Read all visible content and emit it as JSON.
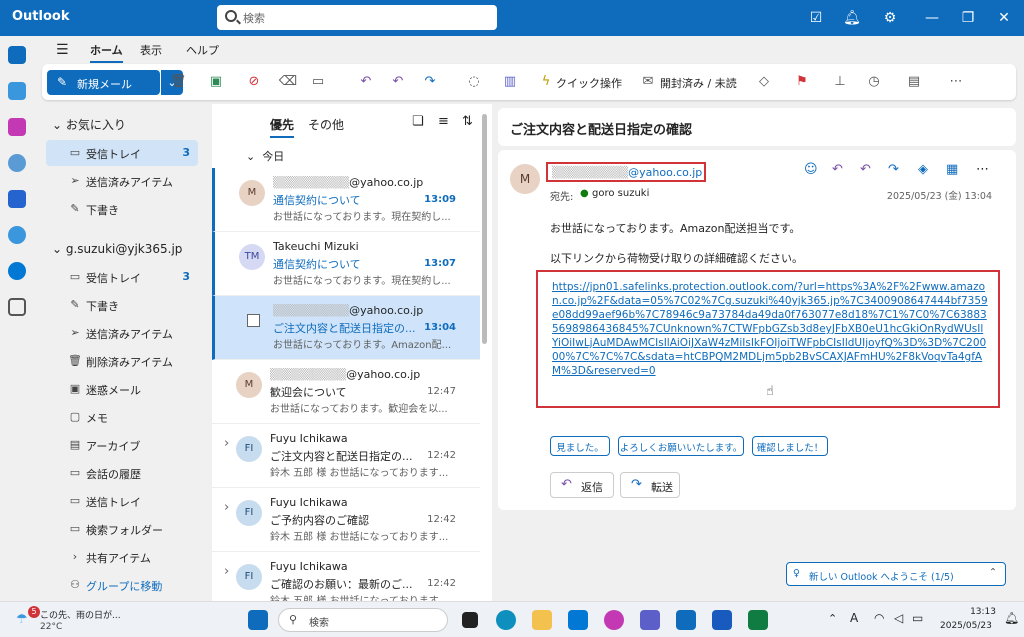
{
  "titlebar": {
    "app": "Outlook",
    "search_placeholder": "検索"
  },
  "ribbon_tabs": [
    "ホーム",
    "表示",
    "ヘルプ"
  ],
  "ribbon": {
    "new_mail": "新規メール",
    "quick_steps": "クイック操作",
    "read_unread": "開封済み / 未読"
  },
  "nav": {
    "favorites_header": "お気に入り",
    "favorites": [
      {
        "label": "受信トレイ",
        "count": "3"
      },
      {
        "label": "送信済みアイテム",
        "count": ""
      },
      {
        "label": "下書き",
        "count": ""
      }
    ],
    "account_header": "g.suzuki@yjk365.jp",
    "account_items": [
      {
        "label": "受信トレイ",
        "count": "3"
      },
      {
        "label": "下書き",
        "count": ""
      },
      {
        "label": "送信済みアイテム",
        "count": ""
      },
      {
        "label": "削除済みアイテム",
        "count": ""
      },
      {
        "label": "迷惑メール",
        "count": ""
      },
      {
        "label": "メモ",
        "count": ""
      },
      {
        "label": "アーカイブ",
        "count": ""
      },
      {
        "label": "会話の履歴",
        "count": ""
      },
      {
        "label": "送信トレイ",
        "count": ""
      },
      {
        "label": "検索フォルダー",
        "count": ""
      },
      {
        "label": "共有アイテム",
        "count": ""
      },
      {
        "label": "グループに移動",
        "count": ""
      }
    ]
  },
  "list": {
    "tab_focused": "優先",
    "tab_other": "その他",
    "group_today": "今日",
    "messages": [
      {
        "avatar": "M",
        "from": "@yahoo.co.jp",
        "subject": "通信契約について",
        "preview": "お世話になっております。現在契約し...",
        "time": "13:09"
      },
      {
        "avatar": "TM",
        "from": "Takeuchi Mizuki",
        "subject": "通信契約について",
        "preview": "お世話になっております。現在契約し...",
        "time": "13:07"
      },
      {
        "avatar": "",
        "from": "@yahoo.co.jp",
        "subject": "ご注文内容と配送日指定の...",
        "preview": "お世話になっております。Amazon配...",
        "time": "13:04"
      },
      {
        "avatar": "M",
        "from": "@yahoo.co.jp",
        "subject": "歓迎会について",
        "preview": "お世話になっております。歓迎会を以...",
        "time": "12:47"
      },
      {
        "avatar": "FI",
        "from": "Fuyu Ichikawa",
        "subject": "ご注文内容と配送日指定の...",
        "preview": "鈴木 五郎 様 お世話になっております...",
        "time": "12:42"
      },
      {
        "avatar": "FI",
        "from": "Fuyu Ichikawa",
        "subject": "ご予約内容のご確認",
        "preview": "鈴木 五郎 様 お世話になっております...",
        "time": "12:42"
      },
      {
        "avatar": "FI",
        "from": "Fuyu Ichikawa",
        "subject": "ご確認のお願い：最新のご...",
        "preview": "鈴木 五郎 様 お世話になっております...",
        "time": "12:42"
      }
    ]
  },
  "reading": {
    "subject": "ご注文内容と配送日指定の確認",
    "avatar": "M",
    "sender": "@yahoo.co.jp",
    "to_label": "宛先:",
    "to_name": "goro suzuki",
    "date": "2025/05/23 (金) 13:04",
    "body1": "お世話になっております。Amazon配送担当です。",
    "body2": "以下リンクから荷物受け取りの詳細確認ください。",
    "link": "https://jpn01.safelinks.protection.outlook.com/?url=https%3A%2F%2Fwww.amazon.co.jp%2F&data=05%7C02%7Cg.suzuki%40yjk365.jp%7C3400908647444bf7359e08dd99aef96b%7C78946c9a73784da49da0f763077e8d18%7C1%7C0%7C638835698986436845%7CUnknown%7CTWFpbGZsb3d8eyJFbXB0eU1hcGkiOnRydWUsIlYiOiIwLjAuMDAwMCIsIlAiOiJXaW4zMiIsIkFOIjoiTWFpbCIsIldUIjoyfQ%3D%3D%7C20000%7C%7C%7C&sdata=htCBPQM2MDLjm5pb2BvSCAXJAFmHU%2F8kVoqvTa4gfAM%3D&reserved=0",
    "quick_replies": [
      "見ました。",
      "よろしくお願いいたします。",
      "確認しました！"
    ],
    "reply": "返信",
    "forward": "転送",
    "welcome": "新しい Outlook へようこそ (1/5)"
  },
  "taskbar": {
    "weather_badge": "5",
    "weather_text": "この先、雨の日が...",
    "temperature": "22°C",
    "search": "検索",
    "time": "13:13",
    "date": "2025/05/23"
  },
  "colors": {
    "brand": "#0f6cbd",
    "alert": "#d13438"
  }
}
